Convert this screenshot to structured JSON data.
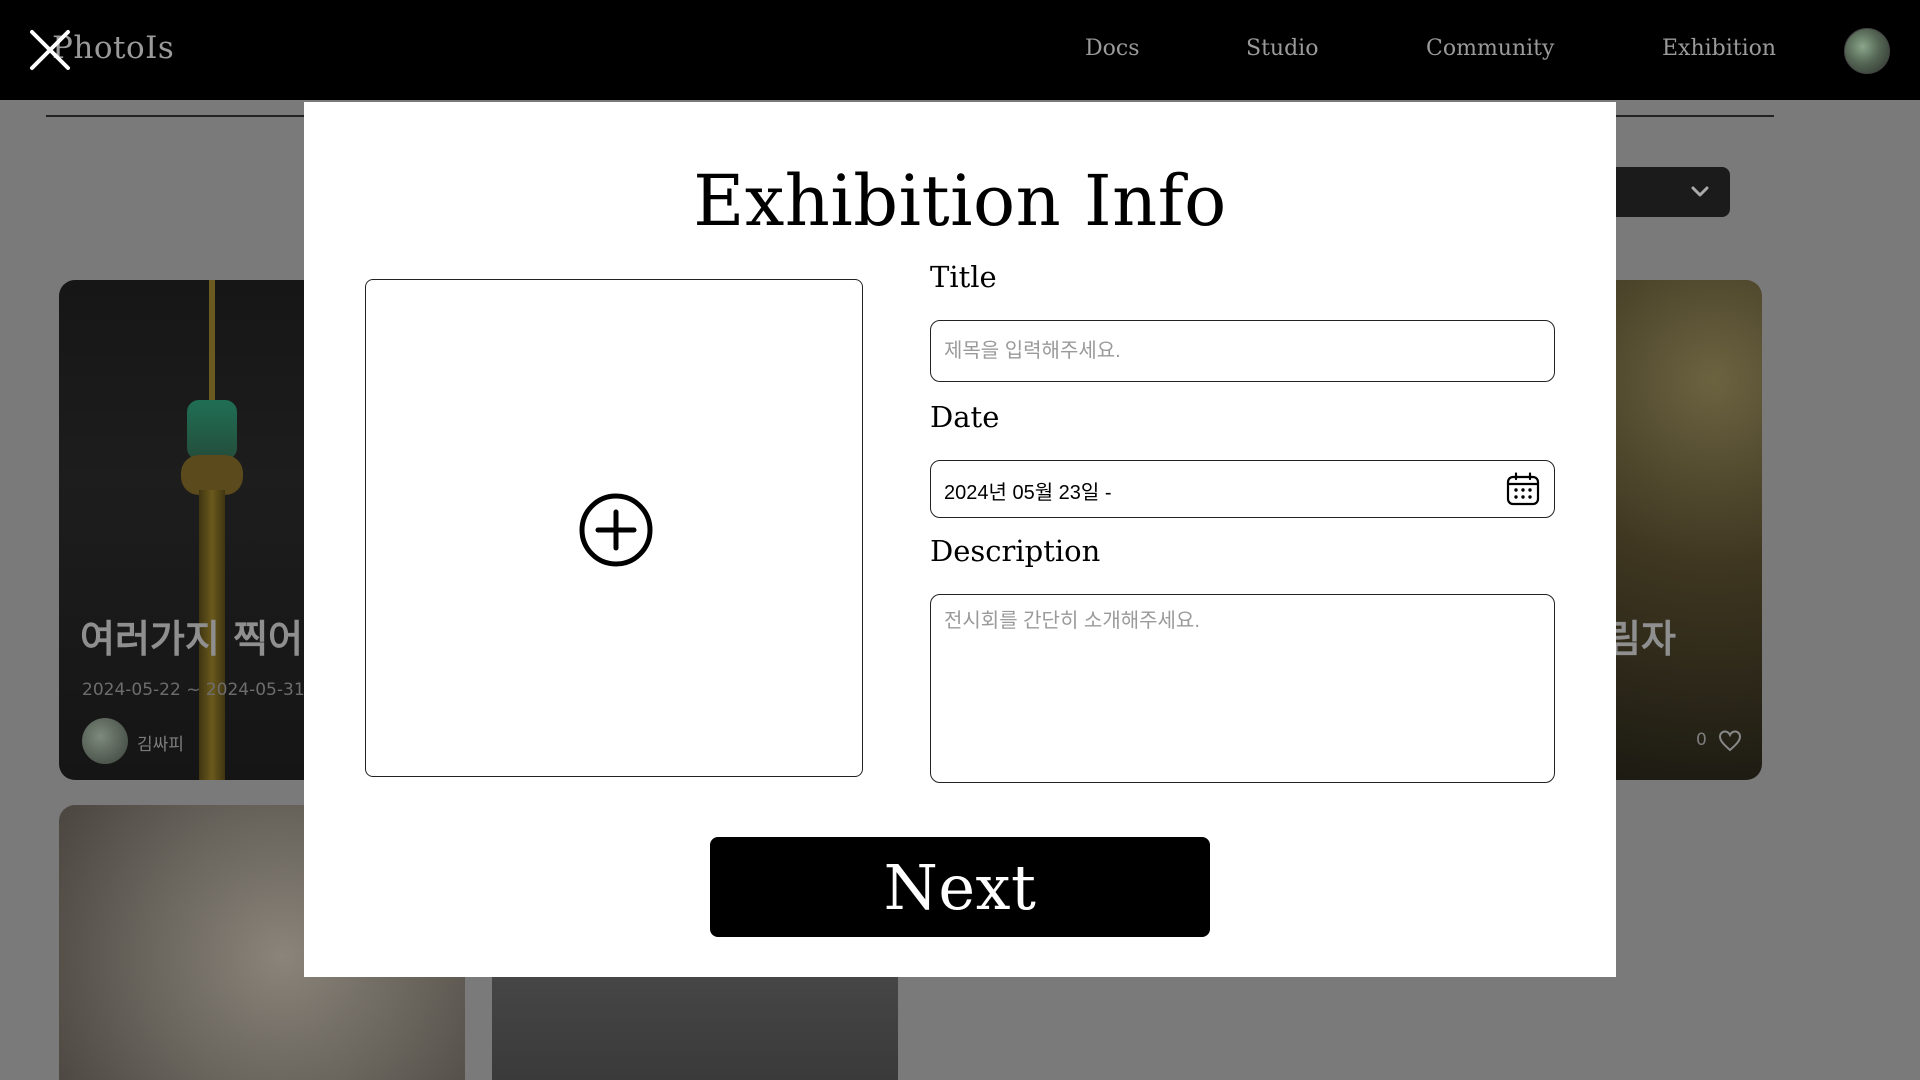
{
  "header": {
    "logo": "PhotoIs",
    "nav": [
      "Docs",
      "Studio",
      "Community",
      "Exhibition"
    ]
  },
  "background": {
    "cards": [
      {
        "title": "여러가지 찍어",
        "date": "2024-05-22 ~ 2024-05-31",
        "author": "김싸피"
      },
      {
        "title": "림자",
        "likes": "0"
      }
    ]
  },
  "modal": {
    "title": "Exhibition Info",
    "title_label": "Title",
    "title_placeholder": "제목을 입력해주세요.",
    "date_label": "Date",
    "date_value": "2024년 05월 23일 -",
    "description_label": "Description",
    "description_placeholder": "전시회를 간단히 소개해주세요.",
    "next_label": "Next"
  },
  "colors": {
    "overlay": "#7a7a7a",
    "modal_bg": "#ffffff",
    "button_bg": "#000000"
  },
  "icons": [
    "close-icon",
    "avatar",
    "chevron-down-icon",
    "plus-circle-icon",
    "calendar-icon",
    "heart-icon"
  ]
}
